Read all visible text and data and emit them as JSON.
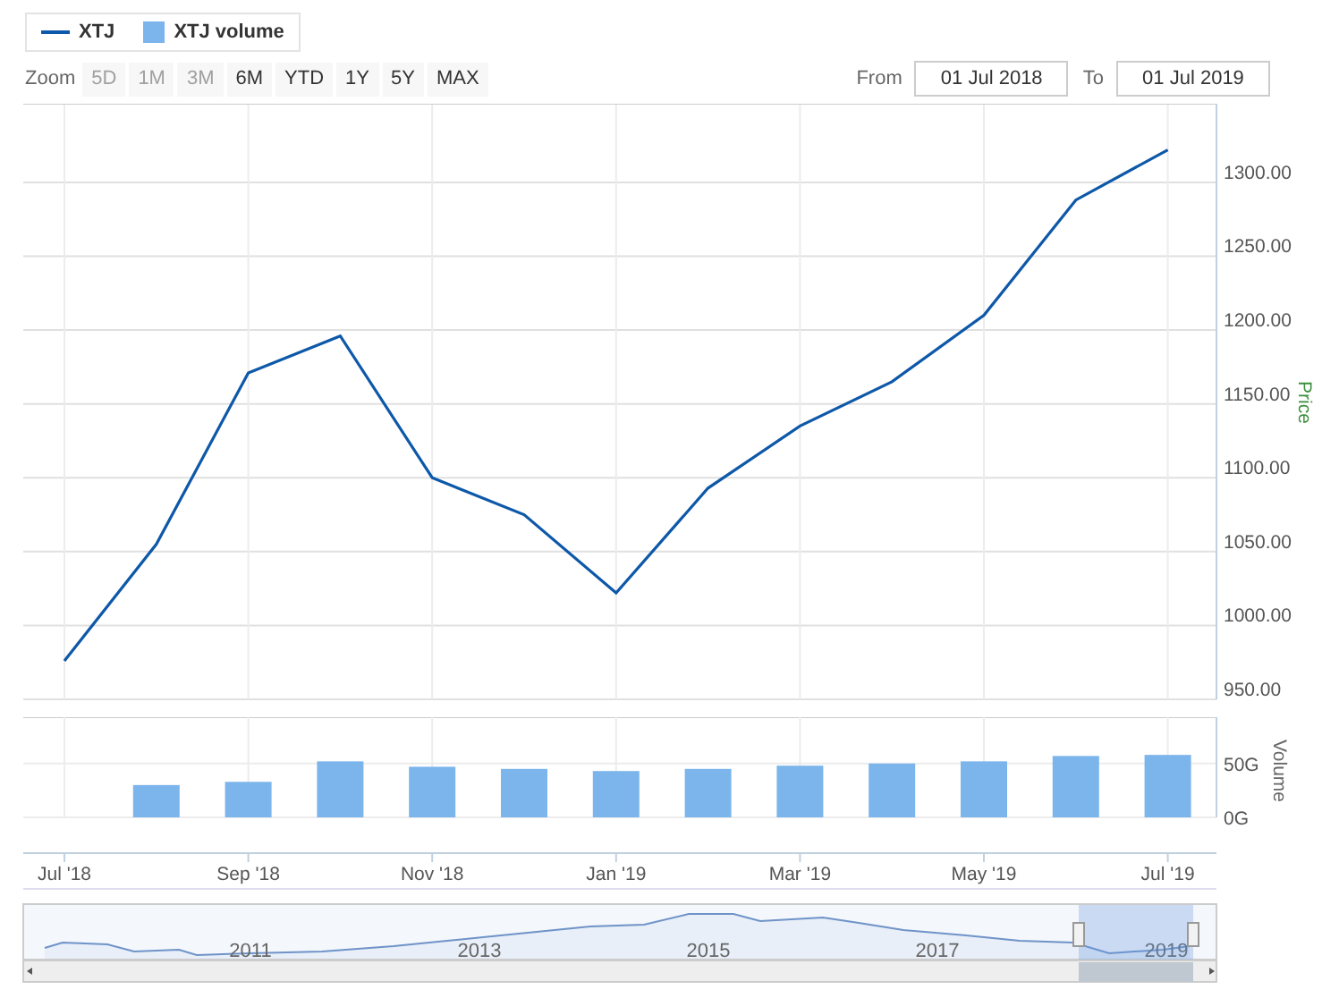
{
  "zoom": {
    "label": "Zoom",
    "buttons": [
      {
        "label": "5D",
        "disabled": true
      },
      {
        "label": "1M",
        "disabled": true
      },
      {
        "label": "3M",
        "disabled": true
      },
      {
        "label": "6M",
        "disabled": false
      },
      {
        "label": "YTD",
        "disabled": false
      },
      {
        "label": "1Y",
        "disabled": false
      },
      {
        "label": "5Y",
        "disabled": false
      },
      {
        "label": "MAX",
        "disabled": false
      }
    ]
  },
  "range": {
    "from_label": "From",
    "from": "01 Jul 2018",
    "to_label": "To",
    "to": "01 Jul 2019"
  },
  "price_chart": {
    "chart_data": {
      "type": "line",
      "ylabel": "Price",
      "grid": true,
      "categories": [
        null,
        null,
        null,
        null,
        null,
        null,
        null,
        null,
        null,
        null,
        null,
        null,
        null
      ],
      "ylim": [
        950,
        1352
      ],
      "yticks": [
        {
          "value": 950,
          "label": "950.00"
        },
        {
          "value": 1000,
          "label": "1000.00"
        },
        {
          "value": 1050,
          "label": "1050.00"
        },
        {
          "value": 1100,
          "label": "1100.00"
        },
        {
          "value": 1150,
          "label": "1150.00"
        },
        {
          "value": 1200,
          "label": "1200.00"
        },
        {
          "value": 1250,
          "label": "1250.00"
        },
        {
          "value": 1300,
          "label": "1300.00"
        }
      ],
      "series": [
        {
          "name": "XTJ",
          "color": "#0d58a8",
          "values": [
            976,
            1055,
            1171,
            1196,
            1100,
            1075,
            1022,
            1093,
            1135,
            1165,
            1210,
            1288,
            1322
          ]
        }
      ]
    }
  },
  "volume_chart": {
    "chart_data": {
      "type": "bar",
      "ylabel": "Volume",
      "grid": true,
      "categories": [
        "Jul '18",
        null,
        "Sep '18",
        null,
        "Nov '18",
        null,
        "Jan '19",
        null,
        "Mar '19",
        null,
        "May '19",
        null,
        "Jul '19"
      ],
      "ylim": [
        0,
        93
      ],
      "yticks": [
        {
          "value": 0,
          "label": "0G"
        },
        {
          "value": 50,
          "label": "50G"
        }
      ],
      "series": [
        {
          "name": "XTJ volume",
          "color": "#7cb5ec",
          "values": [
            null,
            30,
            33,
            52,
            47,
            45,
            43,
            45,
            48,
            50,
            52,
            57,
            58
          ]
        }
      ]
    }
  },
  "navigator": {
    "labels": [
      "2011",
      "2013",
      "2015",
      "2017",
      "2019"
    ]
  }
}
